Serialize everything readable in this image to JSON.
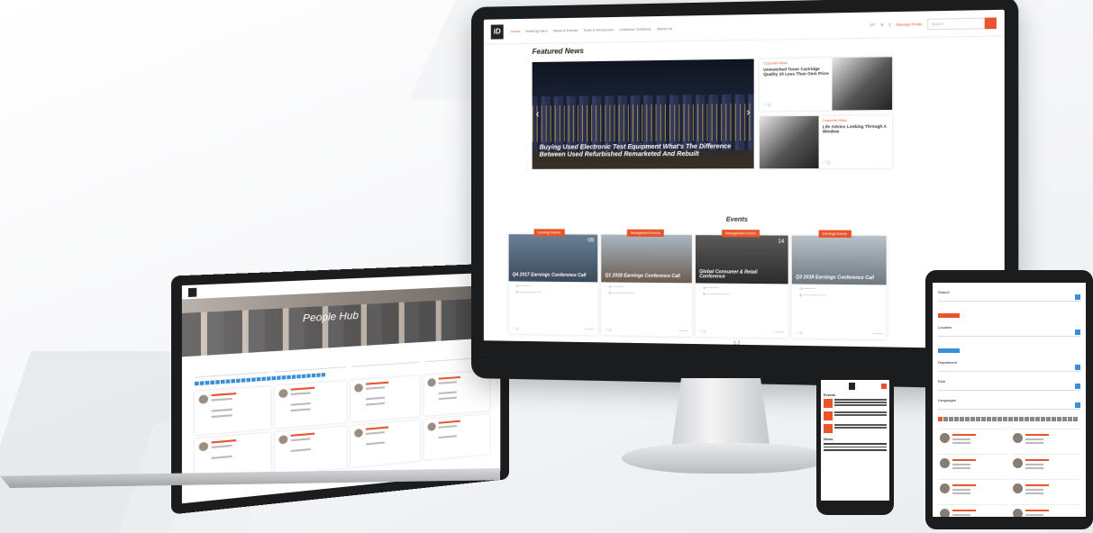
{
  "monitor": {
    "nav": {
      "links": [
        "Home",
        "Working Here",
        "News & Events",
        "Tools & Resources",
        "Customer Solutions",
        "About Us"
      ],
      "right_items": [
        "27°",
        "Manage Profile"
      ],
      "search_placeholder": "Search"
    },
    "featured": {
      "heading": "Featured News",
      "hero_caption": "Buying Used Electronic Test Equipment What's The Difference Between Used Refurbished Remarketed And Rebuilt",
      "side_items": [
        {
          "category": "Corporate News",
          "title": "Unmatched Toner Cartridge Quality 20 Less Than Oem Price"
        },
        {
          "category": "Corporate News",
          "title": "Life Advice Looking Through A Window"
        }
      ]
    },
    "events": {
      "heading": "Events",
      "items": [
        {
          "tag": "Earnings Events",
          "title": "Q4 2017 Earnings Conference Call",
          "day": "09"
        },
        {
          "tag": "Management Events",
          "title": "Q1 2018 Earnings Conference Call",
          "day": ""
        },
        {
          "tag": "Management Events",
          "title": "Global Consumer & Retail Conference",
          "day": "14"
        },
        {
          "tag": "Earnings Events",
          "title": "Q3 2018 Earnings Conference Call",
          "day": ""
        }
      ],
      "pager": "1 2"
    }
  },
  "laptop": {
    "hero_title": "People Hub"
  },
  "tablet": {
    "fields": [
      "Search",
      "Location",
      "Department",
      "Role",
      "Languages"
    ]
  },
  "phone": {
    "section_heading": "Events",
    "news_heading": "News"
  },
  "colors": {
    "accent": "#e8542b",
    "link": "#3a8fd6",
    "device": "#1b1c1e"
  }
}
